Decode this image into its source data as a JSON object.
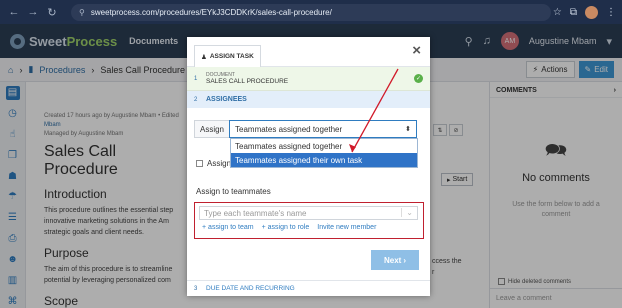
{
  "browser": {
    "url": "sweetprocess.com/procedures/EYkJ3CDDKrK/sales-call-procedure/"
  },
  "app": {
    "logo_left": "Sweet",
    "logo_right": "Process",
    "nav_documents": "Documents",
    "user_initials": "AM",
    "user_name": "Augustine Mbam"
  },
  "breadcrumb": {
    "section": "Procedures",
    "current": "Sales Call Procedure",
    "actions_label": "Actions",
    "edit_label": "Edit"
  },
  "document": {
    "meta_created": "Created 17 hours ago by Augustine Mbam • Edited",
    "meta_created_by_cont": "Mbam",
    "meta_managed": "Managed by Augustine Mbam",
    "title": "Sales Call Procedure",
    "intro_heading": "Introduction",
    "intro_text_1": "This procedure outlines the essential step",
    "intro_text_2": "innovative marketing solutions in the Am",
    "intro_text_3": "strategic goals and client needs.",
    "purpose_heading": "Purpose",
    "purpose_text_1": "The aim of this procedure is to streamline",
    "purpose_text_2": "potential by leveraging personalized com",
    "scope_heading": "Scope",
    "right_text_1": "ccess the",
    "right_text_2": "r",
    "start_label": "Start"
  },
  "comments": {
    "header": "COMMENTS",
    "empty_title": "No comments",
    "hint": "Use the form below to add a comment",
    "hide_deleted": "Hide deleted comments",
    "placeholder": "Leave a comment"
  },
  "modal": {
    "tab_label": "ASSIGN TASK",
    "step1_num": "1",
    "step1_small": "DOCUMENT",
    "step1_title": "SALES CALL PROCEDURE",
    "step2_num": "2",
    "step2_title": "ASSIGNEES",
    "assign_label": "Assign",
    "assign_value": "Teammates assigned together",
    "options": [
      "Teammates assigned together",
      "Teammates assigned their own task"
    ],
    "selected_option_index": 1,
    "assign_self_label": "Assign",
    "assign_teammates_label": "Assign to teammates",
    "teammate_placeholder": "Type each teammate's name",
    "link_team": "assign to team",
    "link_role": "assign to role",
    "link_invite": "Invite new member",
    "next_label": "Next",
    "step3_num": "3",
    "step3_title": "DUE DATE AND RECURRING"
  },
  "colors": {
    "header_bg": "#2b3e55",
    "accent_blue": "#2f7cc0",
    "highlight_red": "#c0202f",
    "selected_option": "#2f73c7"
  }
}
